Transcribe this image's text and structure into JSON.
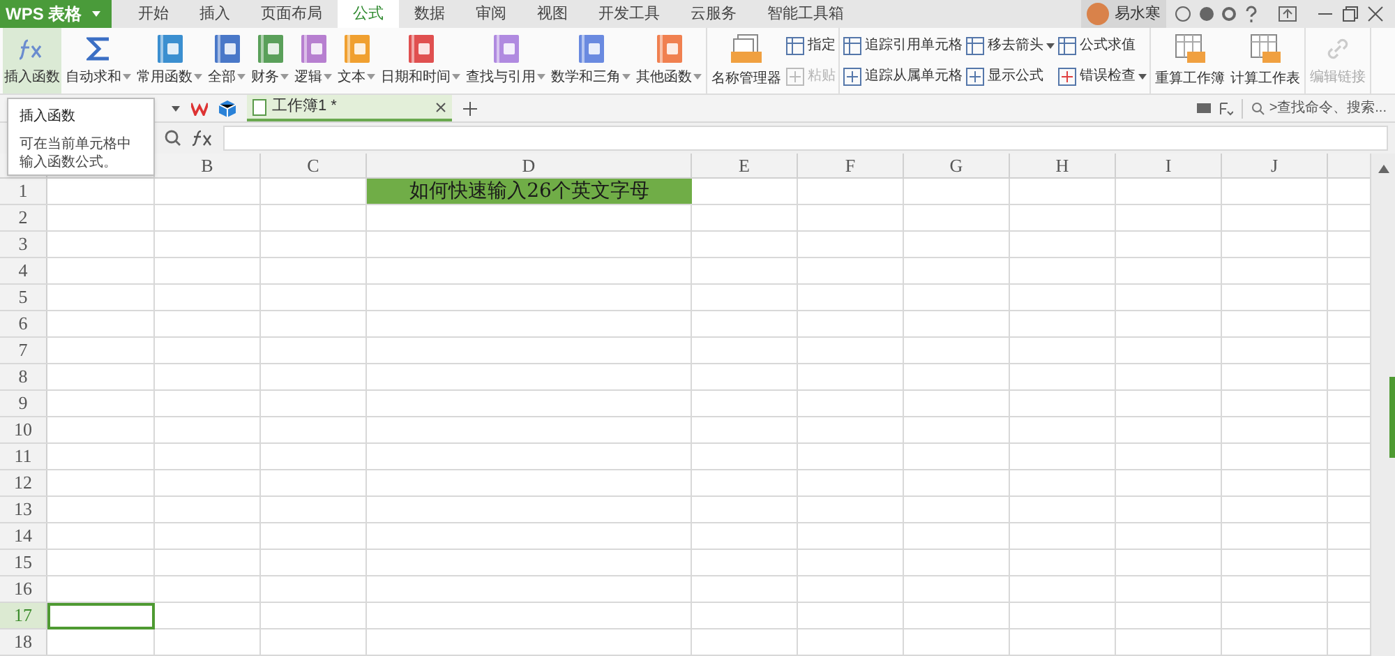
{
  "title_bar": {
    "app_button": "WPS 表格",
    "user_name": "易水寒"
  },
  "menu_tabs": [
    {
      "label": "开始",
      "selected": false
    },
    {
      "label": "插入",
      "selected": false
    },
    {
      "label": "页面布局",
      "selected": false
    },
    {
      "label": "公式",
      "selected": true
    },
    {
      "label": "数据",
      "selected": false
    },
    {
      "label": "审阅",
      "selected": false
    },
    {
      "label": "视图",
      "selected": false
    },
    {
      "label": "开发工具",
      "selected": false
    },
    {
      "label": "云服务",
      "selected": false
    },
    {
      "label": "智能工具箱",
      "selected": false
    }
  ],
  "ribbon": {
    "groups": [
      {
        "items": [
          {
            "kind": "large",
            "label": "插入函数",
            "dropdown": false,
            "highlighted": true,
            "disabled": false
          },
          {
            "kind": "large",
            "label": "自动求和",
            "dropdown": true,
            "highlighted": false,
            "disabled": false
          },
          {
            "kind": "large",
            "label": "常用函数",
            "dropdown": true,
            "highlighted": false,
            "disabled": false,
            "color": "#3b8fd0"
          },
          {
            "kind": "large",
            "label": "全部",
            "dropdown": true,
            "highlighted": false,
            "disabled": false,
            "color": "#4a78c8"
          },
          {
            "kind": "large",
            "label": "财务",
            "dropdown": true,
            "highlighted": false,
            "disabled": false,
            "color": "#5aa05a"
          },
          {
            "kind": "large",
            "label": "逻辑",
            "dropdown": true,
            "highlighted": false,
            "disabled": false,
            "color": "#b77fd0"
          },
          {
            "kind": "large",
            "label": "文本",
            "dropdown": true,
            "highlighted": false,
            "disabled": false,
            "color": "#f0a030"
          },
          {
            "kind": "large",
            "label": "日期和时间",
            "dropdown": true,
            "highlighted": false,
            "disabled": false,
            "color": "#e05050"
          },
          {
            "kind": "large",
            "label": "查找与引用",
            "dropdown": true,
            "highlighted": false,
            "disabled": false,
            "color": "#b08ae0"
          },
          {
            "kind": "large",
            "label": "数学和三角",
            "dropdown": true,
            "highlighted": false,
            "disabled": false,
            "color": "#6a8ae0"
          },
          {
            "kind": "large",
            "label": "其他函数",
            "dropdown": true,
            "highlighted": false,
            "disabled": false,
            "color": "#f08050"
          }
        ]
      },
      {
        "items": [
          {
            "kind": "large",
            "label": "名称管理器",
            "dropdown": false,
            "highlighted": false,
            "disabled": false
          },
          {
            "kind": "small_column",
            "items": [
              {
                "label": "指定",
                "dropdown": false,
                "disabled": false
              },
              {
                "label": "粘贴",
                "dropdown": false,
                "disabled": true
              }
            ]
          }
        ]
      },
      {
        "items": [
          {
            "kind": "small_column",
            "items": [
              {
                "label": "追踪引用单元格",
                "dropdown": false,
                "disabled": false
              },
              {
                "label": "追踪从属单元格",
                "dropdown": false,
                "disabled": false
              }
            ]
          },
          {
            "kind": "small_column",
            "items": [
              {
                "label": "移去箭头",
                "dropdown": true,
                "disabled": false
              },
              {
                "label": "显示公式",
                "dropdown": false,
                "disabled": false
              }
            ]
          },
          {
            "kind": "small_column",
            "items": [
              {
                "label": "公式求值",
                "dropdown": false,
                "disabled": false
              },
              {
                "label": "错误检查",
                "dropdown": true,
                "disabled": false
              }
            ]
          }
        ]
      },
      {
        "items": [
          {
            "kind": "large",
            "label": "重算工作簿",
            "dropdown": false,
            "highlighted": false,
            "disabled": false
          },
          {
            "kind": "large",
            "label": "计算工作表",
            "dropdown": false,
            "highlighted": false,
            "disabled": false
          }
        ]
      },
      {
        "items": [
          {
            "kind": "large",
            "label": "编辑链接",
            "dropdown": false,
            "highlighted": false,
            "disabled": true
          }
        ]
      }
    ]
  },
  "tooltip": {
    "title": "插入函数",
    "body": "可在当前单元格中输入函数公式。"
  },
  "document_tab": {
    "label": "工作簿1 *"
  },
  "search": {
    "placeholder": ">查找命令、搜索..."
  },
  "columns": [
    {
      "label": "B"
    },
    {
      "label": "C"
    },
    {
      "label": "D"
    },
    {
      "label": "E"
    },
    {
      "label": "F"
    },
    {
      "label": "G"
    },
    {
      "label": "H"
    },
    {
      "label": "I"
    },
    {
      "label": "J"
    }
  ],
  "title_cell": {
    "text": "如何快速输入26个英文字母",
    "color": "#70ad47"
  },
  "rows": [
    {
      "label": "1",
      "selected": false
    },
    {
      "label": "2",
      "selected": false
    },
    {
      "label": "3",
      "selected": false
    },
    {
      "label": "4",
      "selected": false
    },
    {
      "label": "5",
      "selected": false
    },
    {
      "label": "6",
      "selected": false
    },
    {
      "label": "7",
      "selected": false
    },
    {
      "label": "8",
      "selected": false
    },
    {
      "label": "9",
      "selected": false
    },
    {
      "label": "10",
      "selected": false
    },
    {
      "label": "11",
      "selected": false
    },
    {
      "label": "12",
      "selected": false
    },
    {
      "label": "13",
      "selected": false
    },
    {
      "label": "14",
      "selected": false
    },
    {
      "label": "15",
      "selected": false
    },
    {
      "label": "16",
      "selected": false
    },
    {
      "label": "17",
      "selected": true
    },
    {
      "label": "18",
      "selected": false
    }
  ]
}
